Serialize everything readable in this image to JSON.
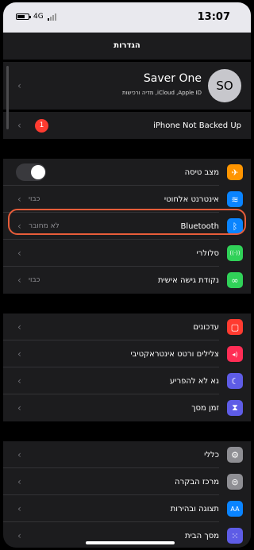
{
  "status_bar": {
    "network": "4G",
    "time": "13:07"
  },
  "nav": {
    "title": "הגדרות"
  },
  "profile": {
    "initials": "SO",
    "name": "Saver One",
    "subtitle": "iCloud ,Apple ID, מדיה ורכישות"
  },
  "backup": {
    "badge": "1",
    "label": "iPhone Not Backed Up"
  },
  "connectivity": [
    {
      "label": "מצב טיסה",
      "value": "",
      "icon": "airplane-icon",
      "color": "#ff9500",
      "glyph": "✈"
    },
    {
      "label": "אינטרנט אלחוטי",
      "value": "כבוי",
      "icon": "wifi-icon",
      "color": "#0a84ff",
      "glyph": "≋"
    },
    {
      "label": "Bluetooth",
      "value": "לא מחובר",
      "icon": "bluetooth-icon",
      "color": "#0a84ff",
      "glyph": "ᛒ"
    },
    {
      "label": "סלולרי",
      "value": "",
      "icon": "cellular-icon",
      "color": "#30d158",
      "glyph": "((·))"
    },
    {
      "label": "נקודת גישה אישית",
      "value": "כבוי",
      "icon": "hotspot-icon",
      "color": "#30d158",
      "glyph": "∞"
    }
  ],
  "notifications": [
    {
      "label": "עדכונים",
      "icon": "notifications-icon",
      "color": "#ff3b30",
      "glyph": "▢"
    },
    {
      "label": "צלילים ורטט אינטראקטיבי",
      "icon": "sounds-icon",
      "color": "#ff2d55",
      "glyph": "◂)"
    },
    {
      "label": "נא לא להפריע",
      "icon": "moon-icon",
      "color": "#5e5ce6",
      "glyph": "☾"
    },
    {
      "label": "זמן מסך",
      "icon": "hourglass-icon",
      "color": "#5e5ce6",
      "glyph": "⧗"
    }
  ],
  "general": [
    {
      "label": "כללי",
      "icon": "gear-icon",
      "color": "#8e8e93",
      "glyph": "⚙"
    },
    {
      "label": "מרכז הבקרה",
      "icon": "control-center-icon",
      "color": "#8e8e93",
      "glyph": "⊜"
    },
    {
      "label": "תצוגה ובהירות",
      "icon": "display-icon",
      "color": "#0a84ff",
      "glyph": "AA"
    },
    {
      "label": "מסך הבית",
      "icon": "home-screen-icon",
      "color": "#5e5ce6",
      "glyph": "⁙"
    }
  ]
}
